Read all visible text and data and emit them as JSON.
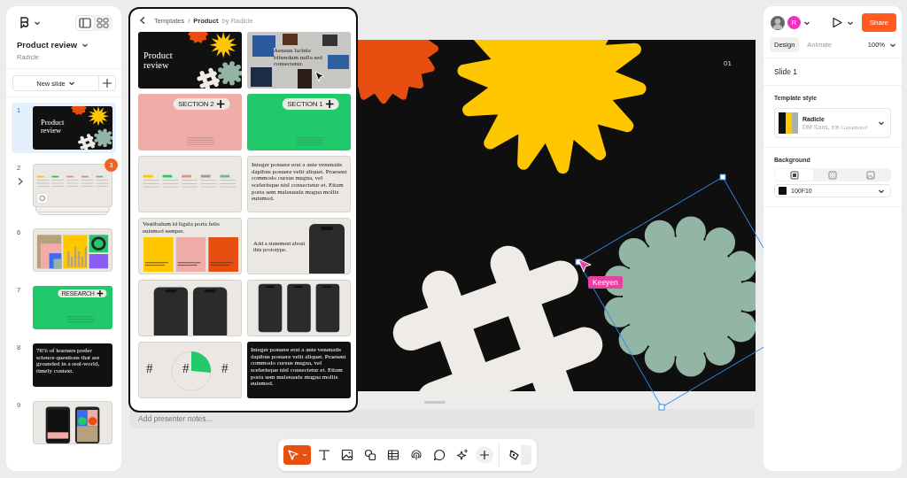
{
  "document": {
    "title": "Product review",
    "team": "Radicle"
  },
  "view_toggle": [
    {
      "selected": true
    },
    {
      "selected": false
    }
  ],
  "new_slide": {
    "label": "New slide"
  },
  "slides": [
    {
      "number": "1",
      "selected": true,
      "kind": "title",
      "title": "Product review"
    },
    {
      "number": "2",
      "selected": false,
      "kind": "table",
      "expanded": false,
      "comment_count": "3"
    },
    {
      "number": "6",
      "selected": false,
      "kind": "chart"
    },
    {
      "number": "7",
      "selected": false,
      "kind": "section",
      "title": "RESEARCH",
      "color": "#22c96a"
    },
    {
      "number": "8",
      "selected": false,
      "kind": "quote",
      "text": "76% of learners prefer science questions that are grounded in a real-world, timely context."
    },
    {
      "number": "9",
      "selected": false,
      "kind": "phones"
    }
  ],
  "templates": {
    "breadcrumb": "Templates",
    "separator": "/",
    "group": "Product",
    "author": "by Radicle",
    "items": [
      {
        "kind": "title",
        "title": "Product review"
      },
      {
        "kind": "photos",
        "caption": "Aenean lacinia bibendum nulla sed consectetur."
      },
      {
        "kind": "section",
        "title": "SECTION 2",
        "color": "#f0aca6"
      },
      {
        "kind": "section",
        "title": "SECTION 1",
        "color": "#22c96a"
      },
      {
        "kind": "table"
      },
      {
        "kind": "paragraph",
        "dark": false,
        "text": "Integer posuere erat a ante venenatis dapibus posuere velit aliquet. Praesent commodo cursus magna, vel scelerisque nisl consectetur et. Etiam porta sem malesuada magna mollis euismod."
      },
      {
        "kind": "columns",
        "text": "Vestibulum id ligula porta felis euismod semper."
      },
      {
        "kind": "statement",
        "text": "Add a statement about this prototype."
      },
      {
        "kind": "phone-pair"
      },
      {
        "kind": "phone-trio"
      },
      {
        "kind": "stats",
        "marks": [
          "#",
          "#",
          "#"
        ]
      },
      {
        "kind": "paragraph",
        "dark": true,
        "text": "Integer posuere erat a ante venenatis dapibus posuere velit aliquet. Praesent commodo cursus magna, vel scelerisque nisl consectetur et. Etiam porta sem malesuada magna mollis euismod."
      }
    ]
  },
  "canvas": {
    "page_number": "01",
    "collaborator": "Keeyen"
  },
  "notes": {
    "placeholder": "Add presenter notes..."
  },
  "toolbar": {
    "tools": [
      {
        "kind": "select",
        "selected": true
      },
      {
        "kind": "text",
        "selected": false
      },
      {
        "kind": "image",
        "selected": false
      },
      {
        "kind": "shape",
        "selected": false
      },
      {
        "kind": "table",
        "selected": false
      },
      {
        "kind": "stamp",
        "selected": false
      },
      {
        "kind": "comment",
        "selected": false
      },
      {
        "kind": "ai",
        "selected": false
      },
      {
        "kind": "more",
        "selected": false
      },
      {
        "kind": "annotate",
        "selected": false
      }
    ]
  },
  "inspector": {
    "avatar_initial": "R",
    "share": "Share",
    "tabs": [
      {
        "label": "Design",
        "selected": true
      },
      {
        "label": "Animate",
        "selected": false
      }
    ],
    "zoom": "100%",
    "slide": "Slide 1",
    "template_style": {
      "heading": "Template style",
      "name": "Radicle",
      "heading_font": "DM Sans,",
      "body_font": "EB Garamond"
    },
    "background": {
      "heading": "Background",
      "fill_types": [
        {
          "selected": true
        },
        {
          "selected": false
        },
        {
          "selected": false
        }
      ],
      "color": "#100f10",
      "value": "100F10"
    }
  }
}
